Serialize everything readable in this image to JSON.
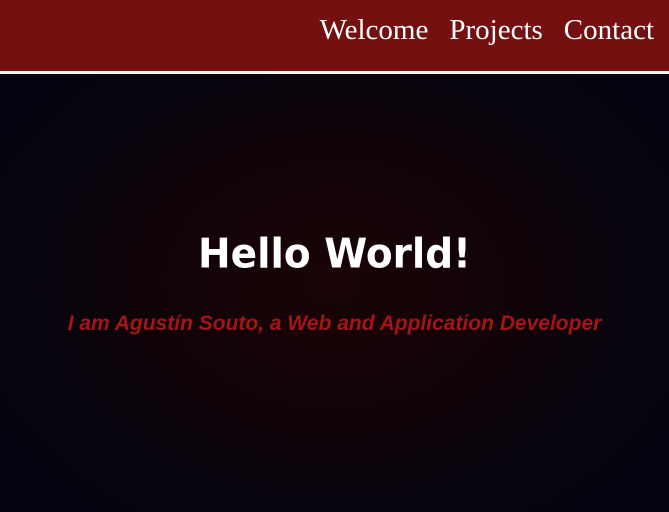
{
  "nav": {
    "items": [
      {
        "label": "Welcome"
      },
      {
        "label": "Projects"
      },
      {
        "label": "Contact"
      }
    ]
  },
  "hero": {
    "title": "Hello World!",
    "subtitle": "I am Agustín Souto, a Web and Application Developer"
  },
  "colors": {
    "navbar_background": "#751010",
    "navbar_border": "#f2f2f2",
    "page_background": "#03030f",
    "subtitle_text": "#a31516"
  }
}
